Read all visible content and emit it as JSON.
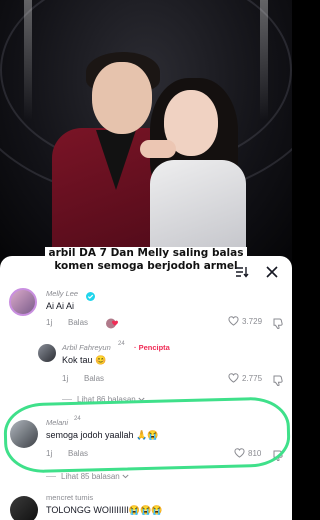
{
  "video": {
    "caption_line1": "arbil DA 7 Dan Melly saling balas",
    "caption_line2": "komen semoga berjodoh armel"
  },
  "sheet": {
    "filter_icon": "filter-sort-icon",
    "close_icon": "close-icon"
  },
  "comments": [
    {
      "username": "Melly Lee",
      "verified": true,
      "text": "Ai Ai Ai",
      "time": "1j",
      "reply_label": "Balas",
      "likes": "3.729"
    },
    {
      "username": "Arbil Fahreyun",
      "badge": "24",
      "creator_label": "Pencipta",
      "text": "Kok tau 😊",
      "time": "1j",
      "reply_label": "Balas",
      "likes": "2.775"
    },
    {
      "view_more": "Lihat 86 balasan"
    },
    {
      "username": "Melani",
      "badge": "24",
      "text": "semoga jodoh yaallah 🙏😭",
      "time": "1j",
      "reply_label": "Balas",
      "likes": "810"
    },
    {
      "view_more": "Lihat 85 balasan"
    },
    {
      "username": "mencret tumis",
      "text": "TOLONGG WOIIIIIIII😭😭😭"
    }
  ],
  "colors": {
    "highlight": "#3fe08a",
    "creator": "#f02c56",
    "muted": "#8a8b91"
  }
}
